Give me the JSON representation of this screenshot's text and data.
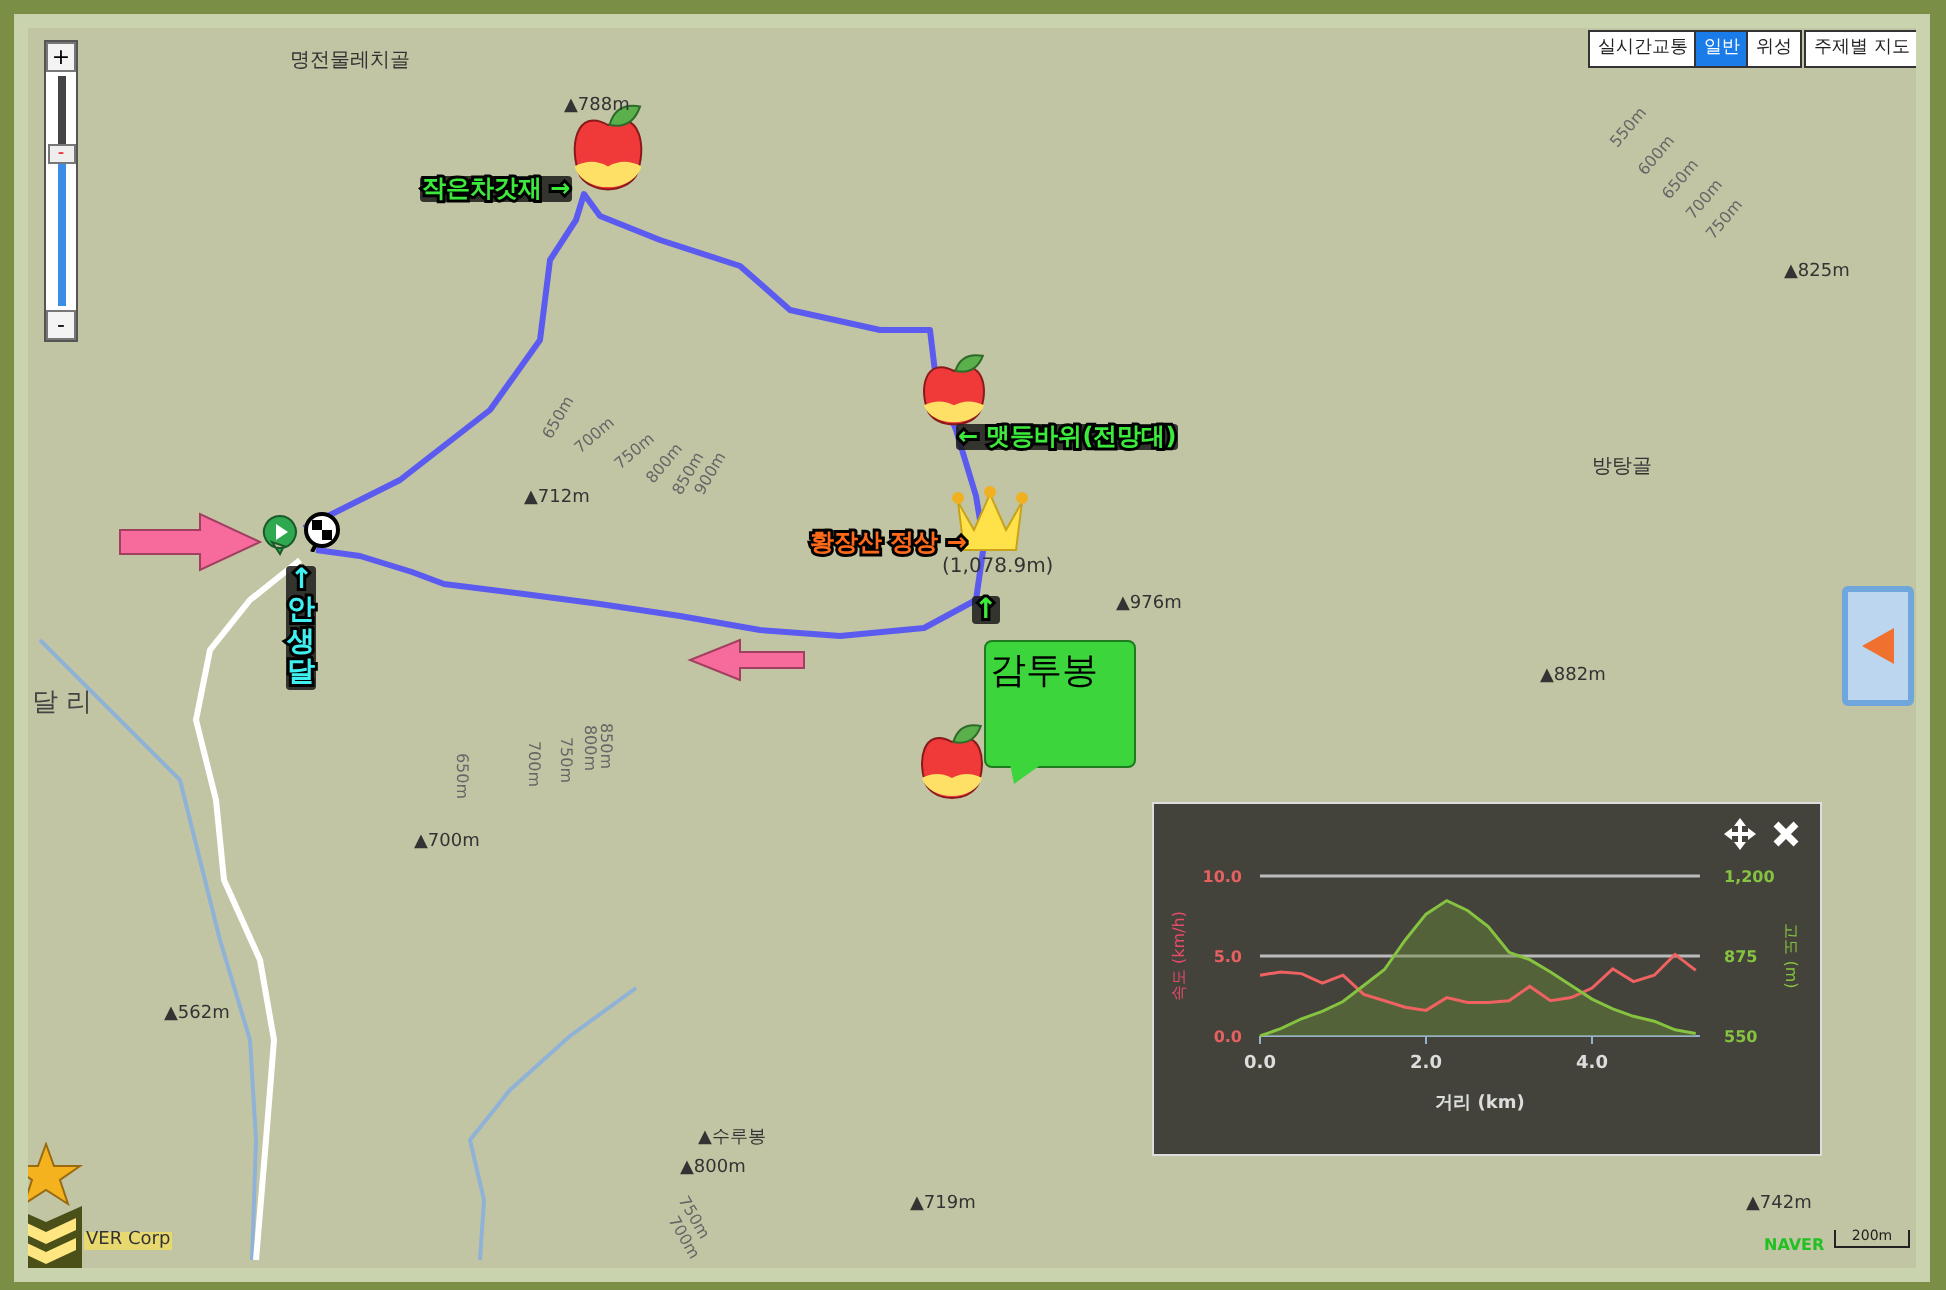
{
  "map_type_buttons": [
    {
      "label": "실시간교통",
      "selected": false
    },
    {
      "label": "일반",
      "selected": true
    },
    {
      "label": "위성",
      "selected": false
    },
    {
      "label": "주제별 지도",
      "selected": false
    }
  ],
  "zoom_control": {
    "plus": "+",
    "minus": "-",
    "thumb": "-",
    "level": 0.66
  },
  "map_labels": [
    {
      "kind": "place",
      "text": "명전물레치골"
    },
    {
      "kind": "peak",
      "text": "▲788m"
    },
    {
      "kind": "peak",
      "text": "▲712m"
    },
    {
      "kind": "place",
      "text": "(1,078.9m)"
    },
    {
      "kind": "peak",
      "text": "▲976m"
    },
    {
      "kind": "peak",
      "text": "▲825m"
    },
    {
      "kind": "place",
      "text": "방탕골"
    },
    {
      "kind": "peak",
      "text": "▲882m"
    },
    {
      "kind": "place",
      "text": "달 리"
    },
    {
      "kind": "peak",
      "text": "▲700m"
    },
    {
      "kind": "peak",
      "text": "▲562m"
    },
    {
      "kind": "peak",
      "text": "▲수루봉"
    },
    {
      "kind": "peak",
      "text": "▲800m"
    },
    {
      "kind": "peak",
      "text": "▲719m"
    },
    {
      "kind": "peak",
      "text": "▲742m"
    },
    {
      "kind": "contour",
      "text": "550m"
    },
    {
      "kind": "contour",
      "text": "600m"
    },
    {
      "kind": "contour",
      "text": "650m"
    },
    {
      "kind": "contour",
      "text": "700m"
    },
    {
      "kind": "contour",
      "text": "750m"
    },
    {
      "kind": "contour",
      "text": "650m"
    },
    {
      "kind": "contour",
      "text": "700m"
    },
    {
      "kind": "contour",
      "text": "750m"
    },
    {
      "kind": "contour",
      "text": "800m"
    },
    {
      "kind": "contour",
      "text": "850m"
    },
    {
      "kind": "contour",
      "text": "900m"
    },
    {
      "kind": "contour",
      "text": "650m"
    },
    {
      "kind": "contour",
      "text": "700m"
    },
    {
      "kind": "contour",
      "text": "750m"
    },
    {
      "kind": "contour",
      "text": "800m"
    },
    {
      "kind": "contour",
      "text": "850m"
    },
    {
      "kind": "contour",
      "text": "750m"
    },
    {
      "kind": "contour",
      "text": "700m"
    }
  ],
  "route_labels": [
    {
      "kind": "waypoint",
      "text": "작은차갓재 →"
    },
    {
      "kind": "waypoint",
      "text": "← 맷등바위(전망대)"
    },
    {
      "kind": "summit",
      "text": "황장산 정상 →"
    },
    {
      "kind": "start",
      "text": "↑안생달"
    },
    {
      "kind": "pointer",
      "text": "↑"
    },
    {
      "kind": "bubble",
      "text": "감투봉"
    }
  ],
  "chart_panel": {
    "chart_data": {
      "type": "line",
      "xlabel": "거리 (km)",
      "x": [
        0,
        0.25,
        0.5,
        0.75,
        1,
        1.25,
        1.5,
        1.75,
        2,
        2.25,
        2.5,
        2.75,
        3,
        3.25,
        3.5,
        3.75,
        4,
        4.25,
        4.5,
        4.75,
        5,
        5.25
      ],
      "series": [
        {
          "name": "속도 (km/h)",
          "color": "#f06262",
          "values": [
            3.8,
            4.0,
            3.9,
            3.3,
            3.8,
            2.6,
            2.2,
            1.8,
            1.6,
            2.4,
            2.1,
            2.1,
            2.2,
            3.1,
            2.2,
            2.4,
            3.0,
            4.2,
            3.4,
            3.8,
            5.1,
            4.1
          ]
        },
        {
          "name": "고도 (m)",
          "color": "#86c340",
          "axis": "y2",
          "values": [
            550,
            580,
            620,
            650,
            690,
            755,
            820,
            940,
            1045,
            1100,
            1060,
            995,
            890,
            860,
            810,
            755,
            700,
            660,
            630,
            610,
            575,
            560
          ]
        }
      ],
      "xlim": [
        0,
        5.3
      ],
      "ylim": [
        0,
        10
      ],
      "y2lim": [
        550,
        1200
      ],
      "xticks": [
        {
          "value": 0,
          "label": "0.0"
        },
        {
          "value": 2,
          "label": "2.0"
        },
        {
          "value": 4,
          "label": "4.0"
        }
      ],
      "yticks": [
        {
          "value": 0,
          "label": "0.0"
        },
        {
          "value": 5,
          "label": "5.0"
        },
        {
          "value": 10,
          "label": "10.0"
        }
      ],
      "y2ticks": [
        {
          "value": 550,
          "label": "550"
        },
        {
          "value": 875,
          "label": "875"
        },
        {
          "value": 1200,
          "label": "1,200"
        }
      ]
    }
  },
  "footer": {
    "copyright": "VER Corp",
    "logo": "NAVER",
    "scale": "200m"
  }
}
